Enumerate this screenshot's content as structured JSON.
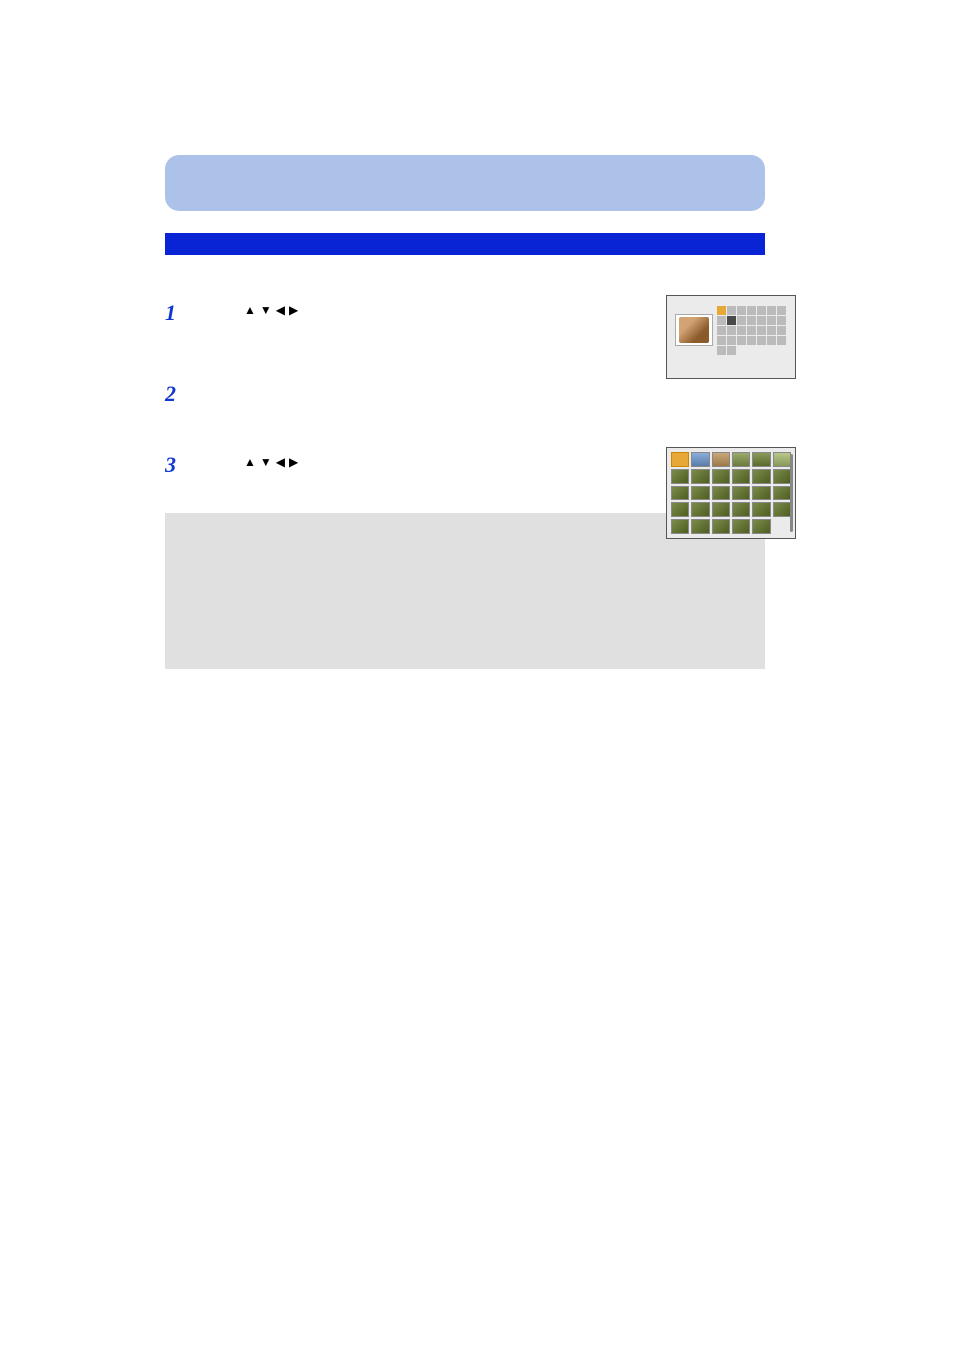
{
  "page_number": "",
  "header_category": "",
  "steps": {
    "step1": {
      "number": "1",
      "arrows": [
        "▲",
        "▼",
        "◀",
        "▶"
      ]
    },
    "step2": {
      "number": "2"
    },
    "step3": {
      "number": "3",
      "arrows": [
        "▲",
        "▼",
        "◀",
        "▶"
      ]
    }
  }
}
